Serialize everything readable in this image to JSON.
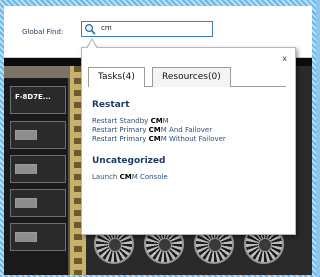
{
  "global_find": {
    "label": "Global Find:",
    "value": "cm"
  },
  "rack": {
    "blade_label": "F-8D7E..."
  },
  "popup": {
    "close": "x",
    "tabs": [
      {
        "label": "Tasks(4)",
        "active": true
      },
      {
        "label": "Resources(0)",
        "active": false
      }
    ],
    "groups": [
      {
        "title": "Restart",
        "items": [
          {
            "pre": "Restart Standby ",
            "match": "CM",
            "post": "M"
          },
          {
            "pre": "Restart Primary ",
            "match": "CM",
            "post": "M And Failover"
          },
          {
            "pre": "Restart Primary ",
            "match": "CM",
            "post": "M Without Failover"
          }
        ]
      },
      {
        "title": "Uncategorized",
        "items": [
          {
            "pre": "Launch ",
            "match": "CM",
            "post": "M Console"
          }
        ]
      }
    ]
  },
  "colors": {
    "accent_blue": "#3c7fb8",
    "link_text": "#2f4f74",
    "heading": "#1f3b62"
  }
}
